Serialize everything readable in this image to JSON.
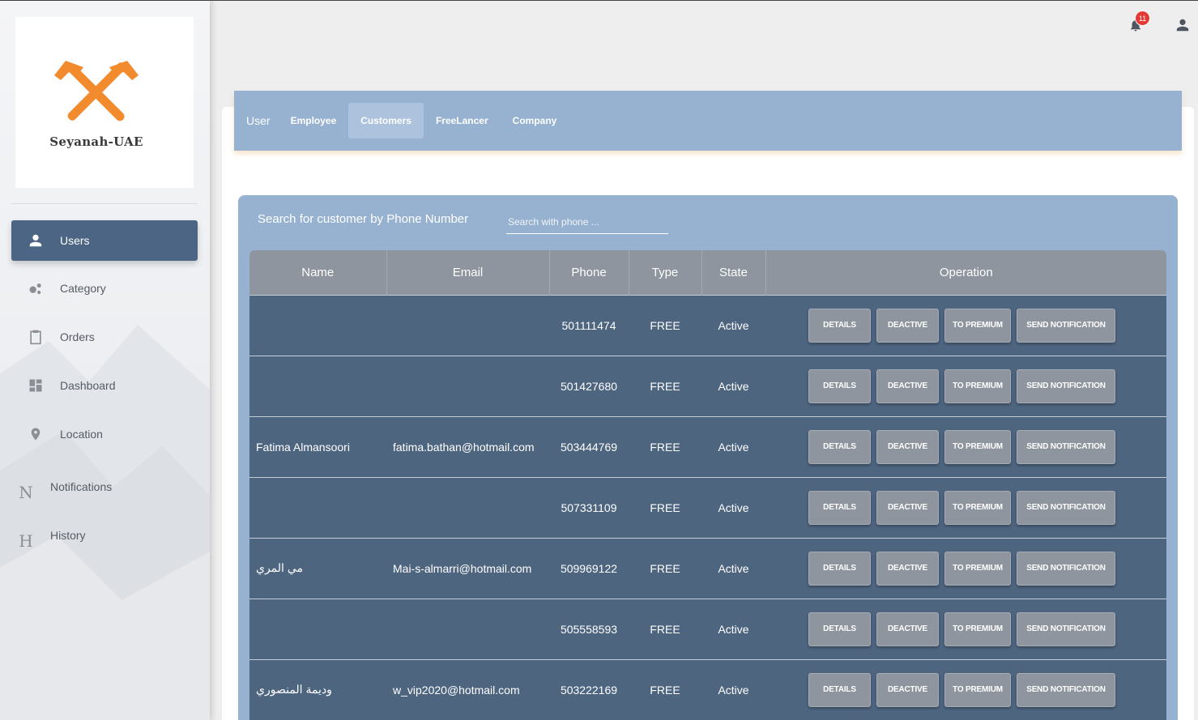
{
  "brand": {
    "name": "Seyanah-UAE",
    "logo_icon": "crossed-hammers-icon",
    "logo_color": "#f28a2e"
  },
  "sidebar": {
    "items": [
      {
        "label": "Users",
        "icon": "person-icon",
        "glyph": "",
        "active": true
      },
      {
        "label": "Category",
        "icon": "bubbles-icon",
        "glyph": "",
        "active": false
      },
      {
        "label": "Orders",
        "icon": "clipboard-icon",
        "glyph": "",
        "active": false
      },
      {
        "label": "Dashboard",
        "icon": "dashboard-icon",
        "glyph": "",
        "active": false
      },
      {
        "label": "Location",
        "icon": "location-pin-icon",
        "glyph": "",
        "active": false
      },
      {
        "label": "Notifications",
        "icon": "letter-n-icon",
        "glyph": "N",
        "active": false
      },
      {
        "label": "History",
        "icon": "letter-h-icon",
        "glyph": "H",
        "active": false
      }
    ]
  },
  "topbar": {
    "notification_count": "11",
    "bell_icon": "bell-icon",
    "account_icon": "account-icon"
  },
  "tabs": {
    "title": "User",
    "items": [
      {
        "label": "Employee",
        "active": false
      },
      {
        "label": "Customers",
        "active": true
      },
      {
        "label": "FreeLancer",
        "active": false
      },
      {
        "label": "Company",
        "active": false
      }
    ]
  },
  "search": {
    "label": "Search for customer by Phone Number",
    "placeholder": "Search with phone ...",
    "value": ""
  },
  "table": {
    "columns": [
      "Name",
      "Email",
      "Phone",
      "Type",
      "State",
      "Operation"
    ],
    "operations": [
      "DETAILS",
      "DEACTIVE",
      "TO PREMIUM",
      "SEND NOTIFICATION"
    ],
    "rows": [
      {
        "name": "",
        "email": "",
        "phone": "501111474",
        "type": "FREE",
        "state": "Active"
      },
      {
        "name": "",
        "email": "",
        "phone": "501427680",
        "type": "FREE",
        "state": "Active"
      },
      {
        "name": "Fatima Almansoori",
        "email": "fatima.bathan@hotmail.com",
        "phone": "503444769",
        "type": "FREE",
        "state": "Active"
      },
      {
        "name": "",
        "email": "",
        "phone": "507331109",
        "type": "FREE",
        "state": "Active"
      },
      {
        "name": "مي المري",
        "email": "Mai-s-almarri@hotmail.com",
        "phone": "509969122",
        "type": "FREE",
        "state": "Active"
      },
      {
        "name": "",
        "email": "",
        "phone": "505558593",
        "type": "FREE",
        "state": "Active"
      },
      {
        "name": "وديمة المنصوري",
        "email": "w_vip2020@hotmail.com",
        "phone": "503222169",
        "type": "FREE",
        "state": "Active"
      }
    ]
  },
  "colors": {
    "accent": "#4d6584",
    "panel": "#97b2d1",
    "row": "#4e6580",
    "header": "#8e959e",
    "badge": "#e53935"
  }
}
